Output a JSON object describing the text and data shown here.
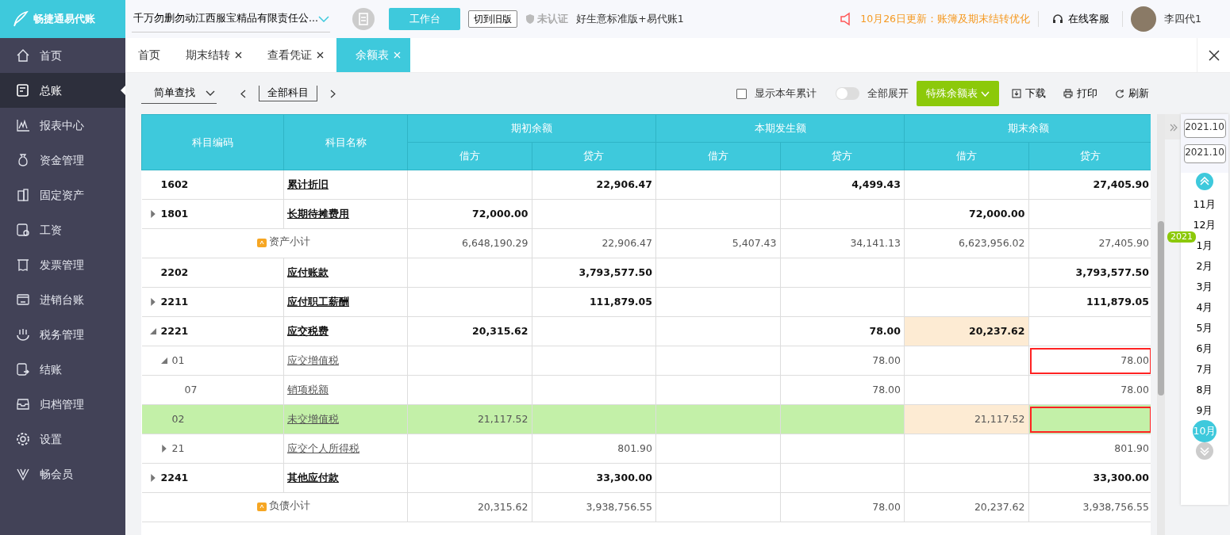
{
  "app": {
    "logo_text": "畅捷通易代账"
  },
  "sidebar": {
    "items": [
      {
        "label": "首页",
        "selected": false
      },
      {
        "label": "总账",
        "selected": true
      },
      {
        "label": "报表中心",
        "selected": false
      },
      {
        "label": "资金管理",
        "selected": false
      },
      {
        "label": "固定资产",
        "selected": false
      },
      {
        "label": "工资",
        "selected": false
      },
      {
        "label": "发票管理",
        "selected": false
      },
      {
        "label": "进销台账",
        "selected": false
      },
      {
        "label": "税务管理",
        "selected": false
      },
      {
        "label": "结账",
        "selected": false
      },
      {
        "label": "归档管理",
        "selected": false
      },
      {
        "label": "设置",
        "selected": false
      },
      {
        "label": "畅会员",
        "selected": false
      }
    ]
  },
  "topbar": {
    "company": "千万勿删勿动江西服宝精品有限责任公...",
    "workbench": "工作台",
    "old_version": "切到旧版",
    "cert_status": "未认证",
    "edition": "好生意标准版+易代账1",
    "notice": "10月26日更新：账簿及期末结转优化",
    "support": "在线客服",
    "user": "李四代1"
  },
  "tabs": [
    {
      "label": "首页",
      "closable": false,
      "selected": false
    },
    {
      "label": "期末结转",
      "closable": true,
      "selected": false
    },
    {
      "label": "查看凭证",
      "closable": true,
      "selected": false
    },
    {
      "label": "余额表",
      "closable": true,
      "selected": true
    }
  ],
  "toolbar": {
    "search_mode": "简单查找",
    "subject_filter": "全部科目",
    "show_year_total": {
      "label": "显示本年累计",
      "checked": false
    },
    "expand_all": {
      "label": "全部展开",
      "on": false
    },
    "special_button": "特殊余额表",
    "download": "下载",
    "print": "打印",
    "refresh": "刷新"
  },
  "table": {
    "columns": [
      "科目编码",
      "科目名称"
    ],
    "groups": [
      {
        "label": "期初余额",
        "subs": [
          "借方",
          "贷方"
        ]
      },
      {
        "label": "本期发生额",
        "subs": [
          "借方",
          "贷方"
        ]
      },
      {
        "label": "期末余额",
        "subs": [
          "借方",
          "贷方"
        ]
      }
    ],
    "rows": [
      {
        "kind": "account",
        "code": "1602",
        "name": "累计折旧",
        "expandable": false,
        "selected": false,
        "open_credit": "22,906.47",
        "period_credit": "4,499.43",
        "end_credit": "27,405.90"
      },
      {
        "kind": "account",
        "code": "1801",
        "name": "长期待摊费用",
        "expandable": true,
        "expanded": false,
        "selected": false,
        "open_debit": "72,000.00",
        "end_debit": "72,000.00"
      },
      {
        "kind": "subtotal",
        "name": "资产小计",
        "selected": false,
        "open_debit": "6,648,190.29",
        "open_credit": "22,906.47",
        "period_debit": "5,407.43",
        "period_credit": "34,141.13",
        "end_debit": "6,623,956.02",
        "end_credit": "27,405.90"
      },
      {
        "kind": "account",
        "code": "2202",
        "name": "应付账款",
        "expandable": false,
        "selected": false,
        "open_credit": "3,793,577.50",
        "end_credit": "3,793,577.50"
      },
      {
        "kind": "account",
        "code": "2211",
        "name": "应付职工薪酬",
        "expandable": true,
        "expanded": false,
        "selected": false,
        "open_credit": "111,879.05",
        "end_credit": "111,879.05"
      },
      {
        "kind": "account",
        "code": "2221",
        "name": "应交税费",
        "expandable": true,
        "expanded": true,
        "selected": false,
        "end_debit_highlighted": true,
        "open_debit": "20,315.62",
        "period_credit": "78.00",
        "end_debit": "20,237.62",
        "children": [
          {
            "kind": "account",
            "code": "01",
            "name": "应交增值税",
            "expandable": true,
            "expanded": true,
            "selected": false,
            "end_credit_outlined": true,
            "period_credit": "78.00",
            "end_credit": "78.00",
            "children": [
              {
                "kind": "account",
                "code": "07",
                "name": "销项税额",
                "expandable": false,
                "selected": false,
                "period_credit": "78.00",
                "end_credit": "78.00"
              }
            ]
          },
          {
            "kind": "account",
            "code": "02",
            "name": "未交增值税",
            "expandable": false,
            "selected": true,
            "end_debit_highlighted": true,
            "end_credit_outlined": true,
            "open_debit": "21,117.52",
            "end_debit": "21,117.52"
          },
          {
            "kind": "account",
            "code": "21",
            "name": "应交个人所得税",
            "expandable": true,
            "expanded": false,
            "selected": false,
            "open_credit": "801.90",
            "end_credit": "801.90"
          }
        ]
      },
      {
        "kind": "account",
        "code": "2241",
        "name": "其他应付款",
        "expandable": true,
        "expanded": false,
        "selected": false,
        "open_credit": "33,300.00",
        "end_credit": "33,300.00"
      },
      {
        "kind": "subtotal",
        "name": "负债小计",
        "selected": false,
        "open_debit": "20,315.62",
        "open_credit": "3,938,756.55",
        "period_credit": "78.00",
        "end_debit": "20,237.62",
        "end_credit": "3,938,756.55"
      }
    ]
  },
  "period_panel": {
    "start": "2021.10",
    "end": "2021.10",
    "year_badge": "2021",
    "months": [
      {
        "label": "11月",
        "selected": false
      },
      {
        "label": "12月",
        "selected": false
      },
      {
        "label": "1月",
        "selected": false
      },
      {
        "label": "2月",
        "selected": false
      },
      {
        "label": "3月",
        "selected": false
      },
      {
        "label": "4月",
        "selected": false
      },
      {
        "label": "5月",
        "selected": false
      },
      {
        "label": "6月",
        "selected": false
      },
      {
        "label": "7月",
        "selected": false
      },
      {
        "label": "8月",
        "selected": false
      },
      {
        "label": "9月",
        "selected": false
      },
      {
        "label": "10月",
        "selected": true
      }
    ]
  }
}
